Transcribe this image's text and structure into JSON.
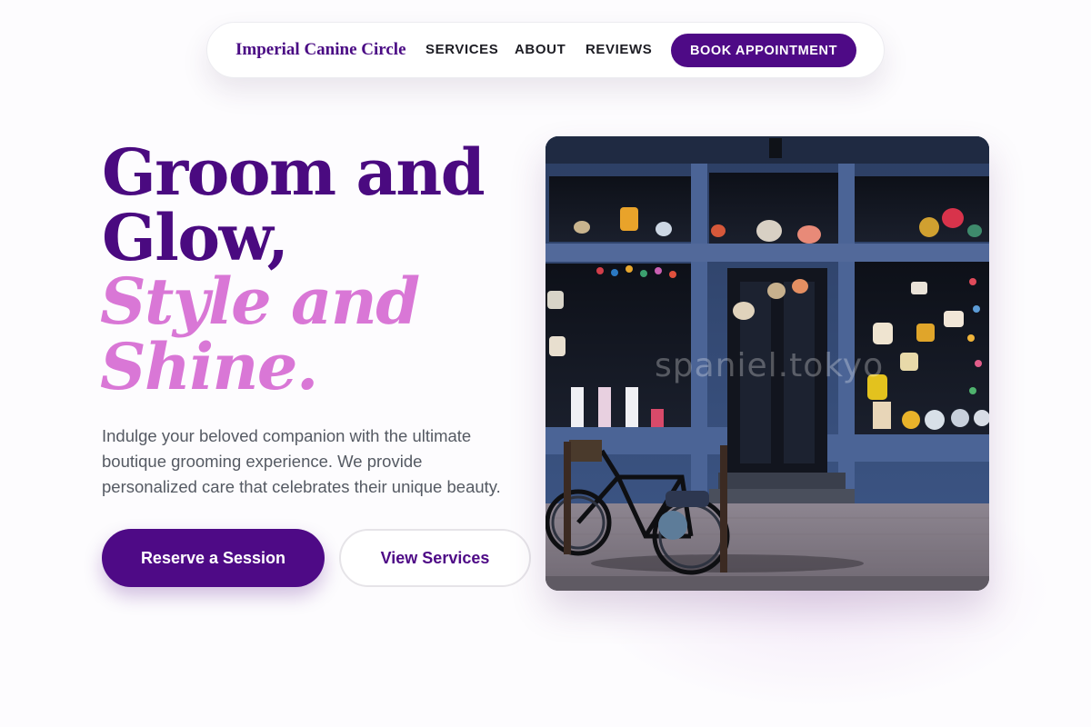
{
  "nav": {
    "brand": "Imperial Canine Circle",
    "links": [
      "SERVICES",
      "ABOUT",
      "REVIEWS"
    ],
    "cta": "BOOK APPOINTMENT"
  },
  "hero": {
    "title_lines": [
      "Groom and",
      "Glow,"
    ],
    "accent_lines": [
      "Style and",
      "Shine."
    ],
    "description_lines": [
      "Indulge your beloved companion with the ultimate",
      "boutique grooming experience. We provide",
      "personalized care that celebrates their unique beauty."
    ],
    "primary_button": "Reserve a Session",
    "secondary_button": "View Services"
  },
  "image": {
    "watermark": "spaniel.tokyo",
    "subject": "storefront-with-bicycle"
  },
  "colors": {
    "brand_purple": "#4e0a86",
    "accent_pink": "#d977d6",
    "text_gray": "#555a63"
  }
}
